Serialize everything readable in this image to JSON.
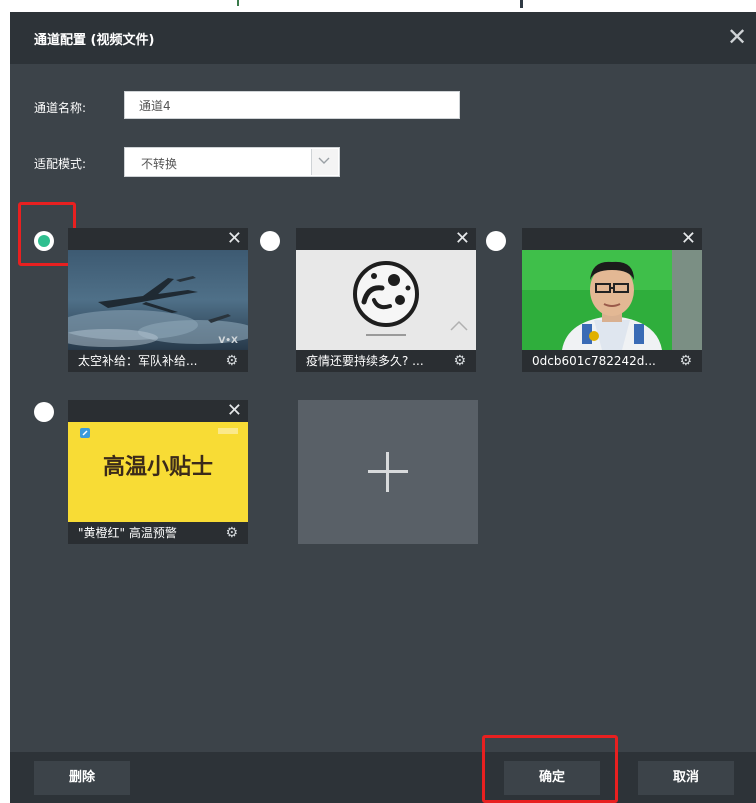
{
  "dialog": {
    "title": "通道配置 (视频文件)",
    "close_icon": "close-icon"
  },
  "form": {
    "name_label": "通道名称:",
    "name_value": "通道4",
    "mode_label": "适配模式:",
    "mode_value": "不转换"
  },
  "cards": [
    {
      "caption": "太空补给：军队补给...",
      "selected": true
    },
    {
      "caption": "疫情还要持续多久? ...",
      "selected": false
    },
    {
      "caption": "0dcb601c782242d...",
      "selected": false
    },
    {
      "caption": "\"黄橙红\" 高温预警",
      "selected": false
    }
  ],
  "thumb_texts": {
    "vox": "V•X",
    "heat_title": "高温小贴士"
  },
  "footer": {
    "delete_label": "删除",
    "confirm_label": "确定",
    "cancel_label": "取消"
  },
  "colors": {
    "dialog_bg": "#3c4349",
    "titlebar_bg": "#2d3338",
    "radio_selected": "#2fbf8f",
    "highlight_red": "#e82020"
  }
}
